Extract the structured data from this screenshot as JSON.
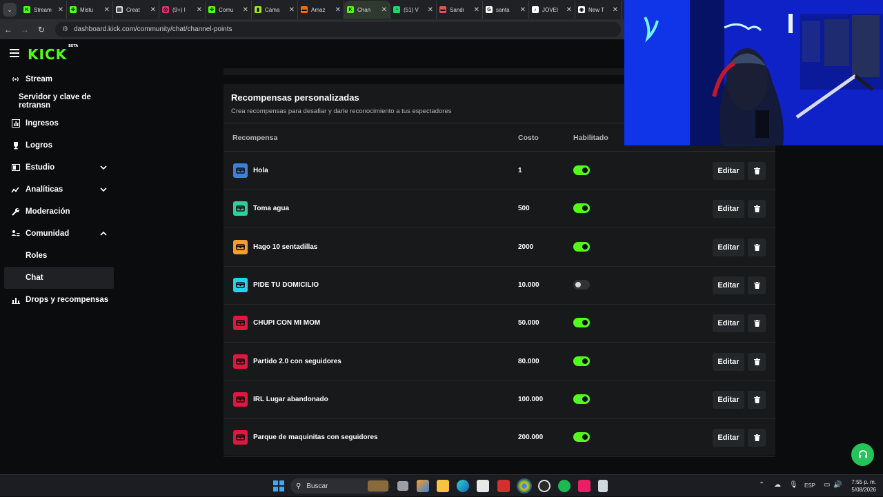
{
  "browser": {
    "tabs": [
      {
        "label": "Stream",
        "color": "#53fc18",
        "glyph": "K"
      },
      {
        "label": "Mistu",
        "color": "#53fc18",
        "glyph": "✣"
      },
      {
        "label": "Creat",
        "color": "#dddddd",
        "glyph": "▤"
      },
      {
        "label": "(9+) I",
        "color": "#e1306c",
        "glyph": "◎"
      },
      {
        "label": "Comu",
        "color": "#53fc18",
        "glyph": "✣"
      },
      {
        "label": "Cáma",
        "color": "#a6e22e",
        "glyph": "▮"
      },
      {
        "label": "Amaz",
        "color": "#ff6a00",
        "glyph": "▬"
      },
      {
        "label": "Chan",
        "color": "#53fc18",
        "glyph": "K"
      },
      {
        "label": "(51) V",
        "color": "#25d366",
        "glyph": "◔"
      },
      {
        "label": "Sandı",
        "color": "#e05555",
        "glyph": "▬"
      },
      {
        "label": "santa",
        "color": "#ffffff",
        "glyph": "G"
      },
      {
        "label": "JÓVEI",
        "color": "#ffffff",
        "glyph": "♪"
      },
      {
        "label": "New T",
        "color": "#ffffff",
        "glyph": "◉"
      }
    ],
    "active_tab_index": 7,
    "url": "dashboard.kick.com/community/chat/channel-points"
  },
  "header": {
    "logo": "KICK",
    "logo_badge": "BETA"
  },
  "sidebar": {
    "items": [
      {
        "label": "Stream",
        "icon": "broadcast-icon"
      },
      {
        "label": "Servidor y clave de retransn",
        "icon": ""
      },
      {
        "label": "Ingresos",
        "icon": "chart-box-icon"
      },
      {
        "label": "Logros",
        "icon": "trophy-icon"
      },
      {
        "label": "Estudio",
        "icon": "layout-icon"
      },
      {
        "label": "Analíticas",
        "icon": "analytics-icon"
      },
      {
        "label": "Moderación",
        "icon": "wrench-icon"
      },
      {
        "label": "Comunidad",
        "icon": "community-icon"
      },
      {
        "label": "Roles",
        "icon": ""
      },
      {
        "label": "Chat",
        "icon": ""
      },
      {
        "label": "Drops y recompensas",
        "icon": "drops-icon"
      }
    ]
  },
  "rewards": {
    "title": "Recompensas personalizadas",
    "subtitle": "Crea recompensas para desafiar y darle reconocimiento a tus espectadores",
    "columns": {
      "reward": "Recompensa",
      "cost": "Costo",
      "enabled": "Habilitado"
    },
    "edit_label": "Editar",
    "rows": [
      {
        "name": "Hola",
        "cost": "1",
        "enabled": true,
        "color": "#3b82d8"
      },
      {
        "name": "Toma agua",
        "cost": "500",
        "enabled": true,
        "color": "#2fcf9d"
      },
      {
        "name": "Hago 10 sentadillas",
        "cost": "2000",
        "enabled": true,
        "color": "#f59e2a"
      },
      {
        "name": "PIDE TU DOMICILIO",
        "cost": "10.000",
        "enabled": false,
        "color": "#22d3ee"
      },
      {
        "name": "CHUPI CON MI MOM",
        "cost": "50.000",
        "enabled": true,
        "color": "#e0173e"
      },
      {
        "name": "Partido 2.0 con seguidores",
        "cost": "80.000",
        "enabled": true,
        "color": "#e0173e"
      },
      {
        "name": "IRL Lugar abandonado",
        "cost": "100.000",
        "enabled": true,
        "color": "#e0173e"
      },
      {
        "name": "Parque de maquinitas con seguidores",
        "cost": "200.000",
        "enabled": true,
        "color": "#e0173e"
      }
    ]
  },
  "taskbar": {
    "search_placeholder": "Buscar",
    "language": "ESP",
    "time": "7:55 p. m.",
    "date": "5/08/2026"
  },
  "colors": {
    "accent": "#53fc18",
    "help": "#24c45a"
  }
}
